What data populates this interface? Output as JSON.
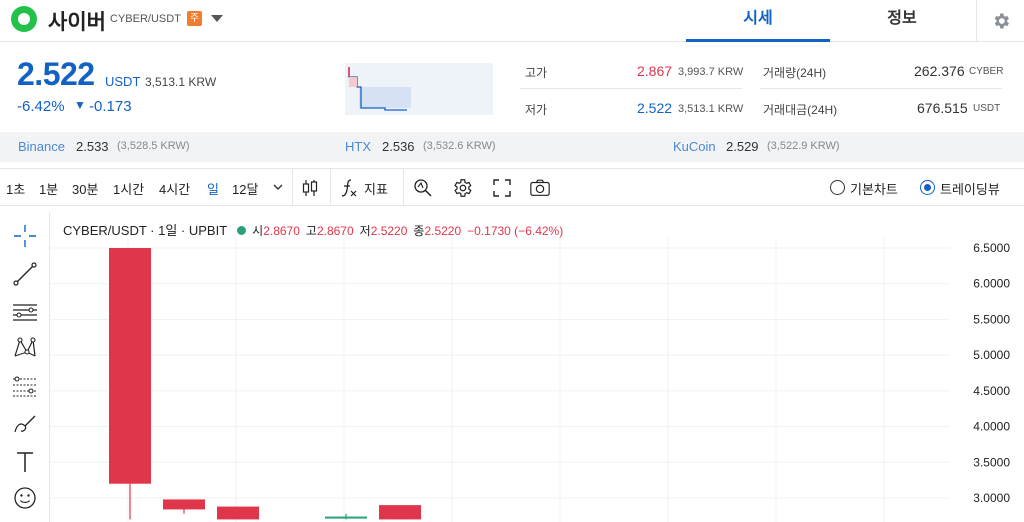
{
  "header": {
    "coin_name": "사이버",
    "pair": "CYBER/USDT",
    "warning_badge": "주",
    "tabs": [
      "시세",
      "정보"
    ]
  },
  "price": {
    "value": "2.522",
    "unit": "USDT",
    "krw": "3,513.1 KRW",
    "change_pct": "-6.42%",
    "change_arrow": "▼",
    "change_val": "-0.173"
  },
  "stats": {
    "high_label": "고가",
    "high_val": "2.867",
    "high_krw": "3,993.7 KRW",
    "low_label": "저가",
    "low_val": "2.522",
    "low_krw": "3,513.1 KRW",
    "volume_label": "거래량(24H)",
    "volume_val": "262.376",
    "volume_unit": "CYBER",
    "amount_label": "거래대금(24H)",
    "amount_val": "676.515",
    "amount_unit": "USDT"
  },
  "exchanges": [
    {
      "name": "Binance",
      "price": "2.533",
      "krw": "(3,528.5 KRW)"
    },
    {
      "name": "HTX",
      "price": "2.536",
      "krw": "(3,532.6 KRW)"
    },
    {
      "name": "KuCoin",
      "price": "2.529",
      "krw": "(3,522.9 KRW)"
    }
  ],
  "toolbar": {
    "timeframes": [
      "1초",
      "1분",
      "30분",
      "1시간",
      "4시간",
      "일",
      "12달"
    ],
    "active_timeframe": "일",
    "indicator_label": "지표",
    "radio_basic": "기본차트",
    "radio_trading": "트레이딩뷰"
  },
  "chart_legend": {
    "title": "CYBER/USDT · 1일 · UPBIT",
    "open_label": "시",
    "open": "2.8670",
    "high_label": "고",
    "high": "2.8670",
    "low_label": "저",
    "low": "2.5220",
    "close_label": "종",
    "close": "2.5220",
    "change": "−0.1730 (−6.42%)"
  },
  "colors": {
    "accent": "#1261c4",
    "up": "#e0364b",
    "down": "#1261c4",
    "candle_teal": "#26a17b"
  },
  "chart_data": {
    "type": "candlestick",
    "y_ticks": [
      "6.5000",
      "6.0000",
      "5.5000",
      "5.0000",
      "4.5000",
      "4.0000",
      "3.5000",
      "3.0000"
    ],
    "ylim": [
      2.7,
      6.7
    ],
    "candles": [
      {
        "open": 6.5,
        "close": 3.2,
        "high": 6.5,
        "low": 2.7,
        "color": "#e0364b"
      },
      {
        "open": 2.98,
        "close": 2.84,
        "high": 2.98,
        "low": 2.78,
        "color": "#e0364b"
      },
      {
        "open": 2.88,
        "close": 2.7,
        "high": 2.88,
        "low": 2.7,
        "color": "#e0364b"
      },
      {
        "open": 2.74,
        "close": 2.72,
        "high": 2.78,
        "low": 2.7,
        "color": "#26a17b"
      },
      {
        "open": 2.9,
        "close": 2.7,
        "high": 2.9,
        "low": 2.7,
        "color": "#e0364b"
      }
    ]
  }
}
